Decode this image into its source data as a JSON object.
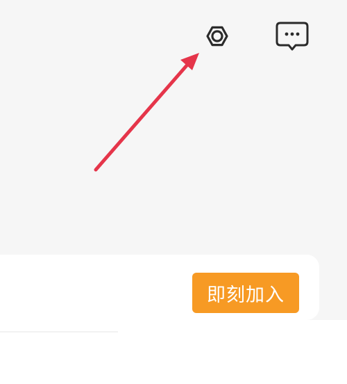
{
  "header": {
    "icons": {
      "settings": "settings-icon",
      "messages": "message-icon"
    }
  },
  "annotation": {
    "arrow_color": "#e5354a"
  },
  "card": {
    "join_label": "即刻加入",
    "join_color": "#f79a24"
  }
}
